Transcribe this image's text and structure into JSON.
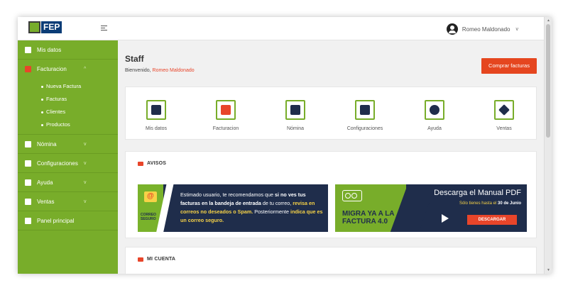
{
  "app": {
    "logo_text": "FEP"
  },
  "colors": {
    "sidebar": "#78ad2a",
    "accent_red": "#e8452a",
    "navy": "#1f2d4b"
  },
  "sidebar": {
    "items": [
      {
        "label": "Mis datos",
        "icon": "user-icon"
      },
      {
        "label": "Facturacion",
        "icon": "invoice-icon",
        "expanded": true
      },
      {
        "label": "Nómina",
        "icon": "payroll-icon"
      },
      {
        "label": "Configuraciones",
        "icon": "gear-icon"
      },
      {
        "label": "Ayuda",
        "icon": "help-icon"
      },
      {
        "label": "Ventas",
        "icon": "tag-icon"
      },
      {
        "label": "Panel principal",
        "icon": "panel-icon"
      }
    ],
    "subitems": [
      "Nueva Factura",
      "Facturas",
      "Clientes",
      "Productos"
    ]
  },
  "topbar": {
    "user_name": "Romeo Maldonado"
  },
  "main": {
    "title": "Staff",
    "welcome_prefix": "Bienvenido,",
    "welcome_user": "Romeo Maldonado",
    "buy_button": "Comprar facturas"
  },
  "shortcuts": [
    {
      "label": "Mis datos",
      "icon": "user-icon"
    },
    {
      "label": "Facturacion",
      "icon": "invoice-icon"
    },
    {
      "label": "Nómina",
      "icon": "payroll-icon"
    },
    {
      "label": "Configuraciones",
      "icon": "gear-icon"
    },
    {
      "label": "Ayuda",
      "icon": "lifebuoy-icon"
    },
    {
      "label": "Ventas",
      "icon": "tag-icon"
    }
  ],
  "avisos": {
    "title": "AVISOS",
    "banner1": {
      "badge": "CORREO SEGURO",
      "line1": "Estimado usuario, te recomendamos que ",
      "line1_bold": "si no ves tus facturas en la bandeja de entrada",
      "line2": " de tu correo, ",
      "line2_yellow": "revisa en correos no deseados o Spam.",
      "line3": " Posteriormente ",
      "line3_yellow": "indica que es un correo seguro."
    },
    "banner2": {
      "heading": "Descarga el Manual PDF",
      "sub_prefix": "Sólo tienes hasta el ",
      "sub_date": "30 de Junio",
      "migra": "MIGRA YA A LA FACTURA 4.0",
      "download": "DESCARGAR"
    }
  },
  "cuenta": {
    "title": "MI CUENTA"
  }
}
